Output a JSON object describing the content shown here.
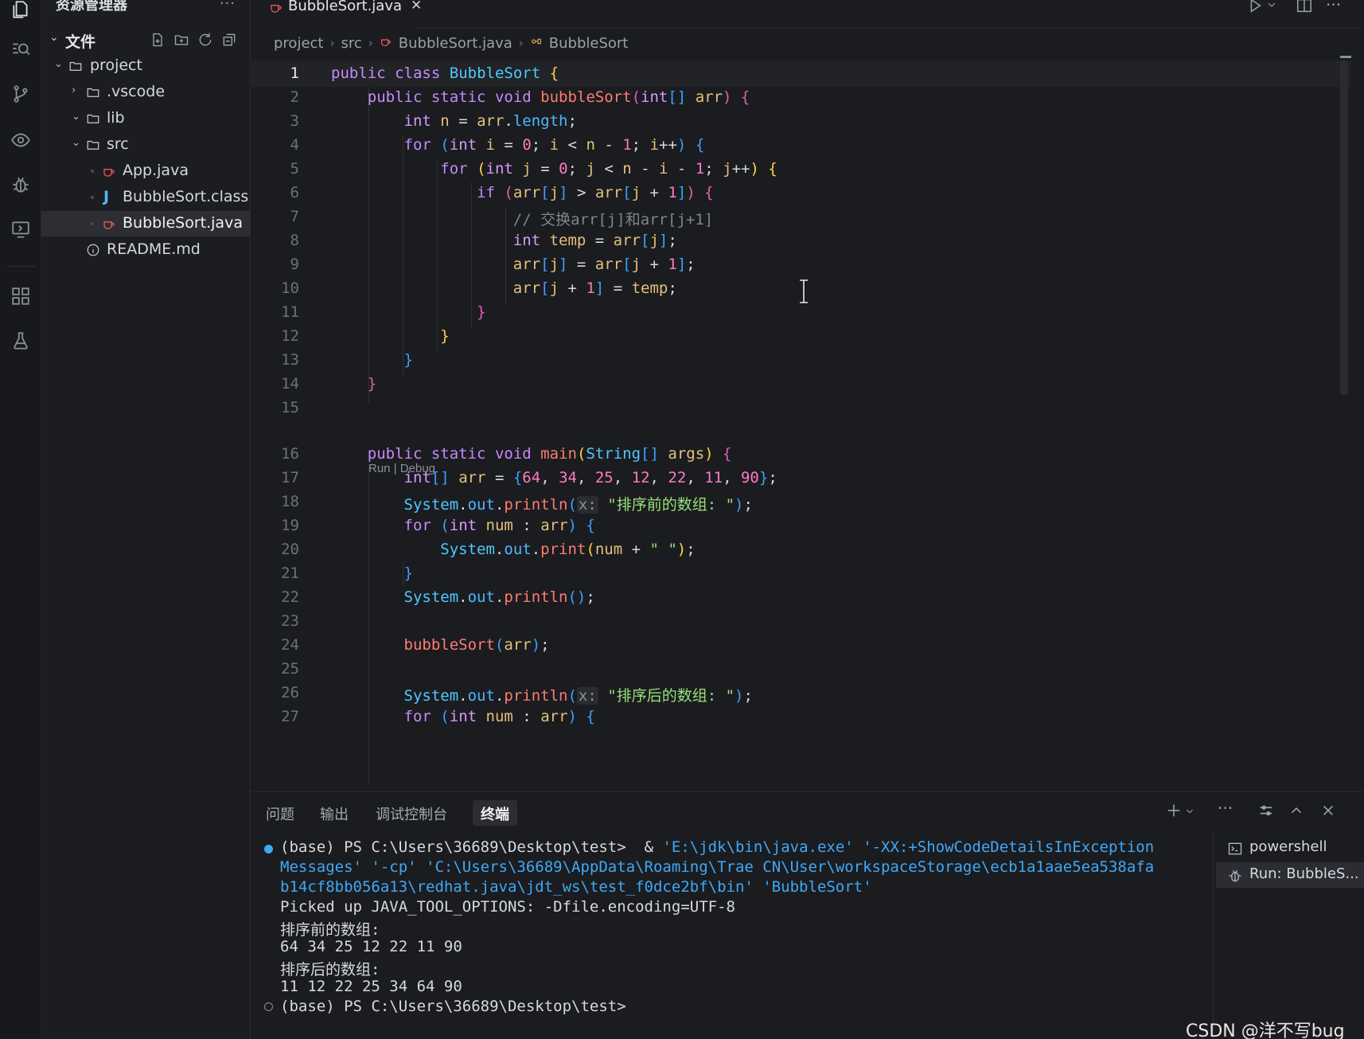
{
  "sidebar": {
    "title": "资源管理器",
    "more": "···",
    "files_label": "文件",
    "tree": [
      {
        "label": "project",
        "chev": "⌄"
      },
      {
        "label": ".vscode",
        "chev": "›"
      },
      {
        "label": "lib",
        "chev": "⌄"
      },
      {
        "label": "src",
        "chev": "⌄"
      },
      {
        "label": "App.java"
      },
      {
        "label": "BubbleSort.class"
      },
      {
        "label": "BubbleSort.java"
      },
      {
        "label": "README.md"
      }
    ]
  },
  "editor": {
    "tab_label": "BubbleSort.java",
    "tab_close": "✕",
    "breadcrumb": [
      "project",
      "src",
      "BubbleSort.java",
      "BubbleSort"
    ],
    "breadcrumb_sep": "›",
    "codelens": "Run | Debug",
    "line_numbers": [
      "1",
      "2",
      "3",
      "4",
      "5",
      "6",
      "7",
      "8",
      "9",
      "10",
      "11",
      "12",
      "13",
      "14",
      "15",
      "16",
      "17",
      "18",
      "19",
      "20",
      "21",
      "22",
      "23",
      "24",
      "25",
      "26",
      "27"
    ],
    "lines": [
      "public class BubbleSort {",
      "    public static void bubbleSort(int[] arr) {",
      "        int n = arr.length;",
      "        for (int i = 0; i < n - 1; i++) {",
      "            for (int j = 0; j < n - i - 1; j++) {",
      "                if (arr[j] > arr[j + 1]) {",
      "                    // 交换arr[j]和arr[j+1]",
      "                    int temp = arr[j];",
      "                    arr[j] = arr[j + 1];",
      "                    arr[j + 1] = temp;",
      "                }",
      "            }",
      "        }",
      "    }",
      "",
      "    public static void main(String[] args) {",
      "        int[] arr = {64, 34, 25, 12, 22, 11, 90};",
      "        System.out.println(x: \"排序前的数组: \");",
      "        for (int num : arr) {",
      "            System.out.print(num + \" \");",
      "        }",
      "        System.out.println();",
      "",
      "        bubbleSort(arr);",
      "",
      "        System.out.println(x: \"排序后的数组: \");",
      "        for (int num : arr) {"
    ]
  },
  "panel": {
    "tabs": [
      "问题",
      "输出",
      "调试控制台",
      "终端"
    ],
    "active_tab": "终端",
    "terminal": {
      "prompt_1": "(base) PS C:\\Users\\36689\\Desktop\\test>",
      "cmd_amp": "&",
      "cmd_1": "'E:\\jdk\\bin\\java.exe' '-XX:+ShowCodeDetailsInException",
      "cmd_2": "Messages' '-cp' 'C:\\Users\\36689\\AppData\\Roaming\\Trae CN\\User\\workspaceStorage\\ecb1a1aae5ea538afa",
      "cmd_3": "b14cf8bb056a13\\redhat.java\\jdt_ws\\test_f0dce2bf\\bin' 'BubbleSort'",
      "out_1": "Picked up JAVA_TOOL_OPTIONS: -Dfile.encoding=UTF-8",
      "out_2": "排序前的数组:",
      "out_3": "64 34 25 12 22 11 90",
      "out_4": "排序后的数组:",
      "out_5": "11 12 22 25 34 64 90",
      "prompt_2": "(base) PS C:\\Users\\36689\\Desktop\\test>"
    },
    "terminal_list": [
      "powershell",
      "Run: BubbleS..."
    ]
  },
  "watermark": "CSDN @洋不写bug",
  "colors": {
    "accent": "#3fa9f5",
    "java_icon": "#ff5a5a",
    "class_icon": "#4fb8ff"
  },
  "icons": [
    "explorer-icon",
    "search-icon",
    "source-control-icon",
    "eye-icon",
    "debug-icon",
    "remote-icon",
    "extensions-icon",
    "flask-icon"
  ]
}
